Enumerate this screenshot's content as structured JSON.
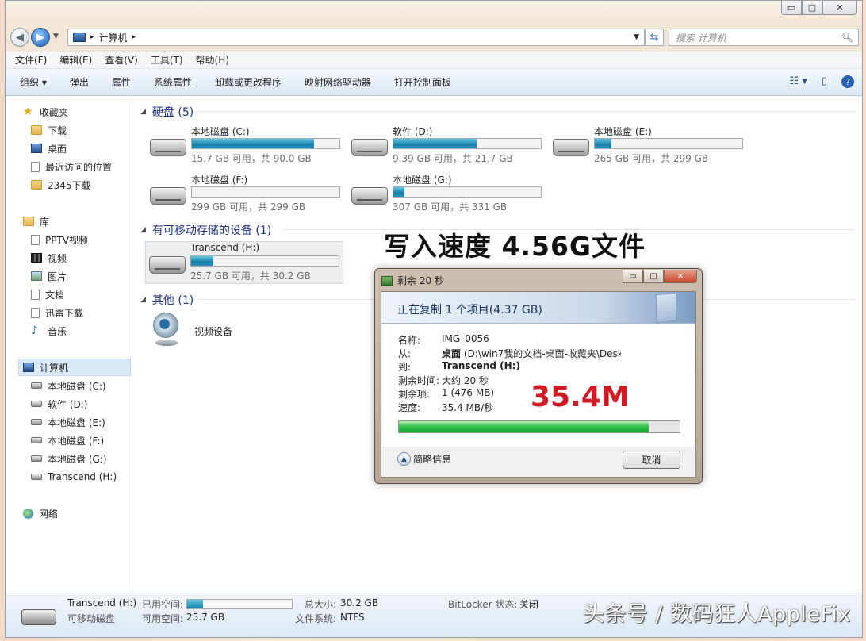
{
  "window": {
    "controls": {
      "minimize": "▭",
      "maximize": "▢",
      "close": "✕"
    }
  },
  "address": {
    "path": "计算机",
    "separator": "▸",
    "search_placeholder": "搜索 计算机"
  },
  "menu": [
    "文件(F)",
    "编辑(E)",
    "查看(V)",
    "工具(T)",
    "帮助(H)"
  ],
  "commands": [
    "组织 ▾",
    "弹出",
    "属性",
    "系统属性",
    "卸载或更改程序",
    "映射网络驱动器",
    "打开控制面板"
  ],
  "nav": {
    "favorites": {
      "label": "收藏夹",
      "items": [
        "下载",
        "桌面",
        "最近访问的位置",
        "2345下载"
      ]
    },
    "libraries": {
      "label": "库",
      "items": [
        "PPTV视频",
        "视频",
        "图片",
        "文档",
        "迅雷下载",
        "音乐"
      ]
    },
    "computer": {
      "label": "计算机",
      "items": [
        "本地磁盘 (C:)",
        "软件 (D:)",
        "本地磁盘 (E:)",
        "本地磁盘 (F:)",
        "本地磁盘 (G:)",
        "Transcend (H:)"
      ]
    },
    "network": {
      "label": "网络"
    }
  },
  "groups": {
    "hdd": "硬盘 (5)",
    "removable": "有可移动存储的设备 (1)",
    "other": "其他 (1)"
  },
  "drives": [
    {
      "name": "本地磁盘 (C:)",
      "info": "15.7 GB 可用，共 90.0 GB",
      "used_fraction": 0.826
    },
    {
      "name": "软件 (D:)",
      "info": "9.39 GB 可用，共 21.7 GB",
      "used_fraction": 0.567
    },
    {
      "name": "本地磁盘 (E:)",
      "info": "265 GB 可用，共 299 GB",
      "used_fraction": 0.114
    },
    {
      "name": "本地磁盘 (F:)",
      "info": "299 GB 可用，共 299 GB",
      "used_fraction": 0.0
    },
    {
      "name": "本地磁盘 (G:)",
      "info": "307 GB 可用，共 331 GB",
      "used_fraction": 0.073
    }
  ],
  "removable": {
    "name": "Transcend (H:)",
    "info": "25.7 GB 可用，共 30.2 GB",
    "used_fraction": 0.149
  },
  "other_device": "视频设备",
  "overlay_title": "写入速度  4.56G文件",
  "dialog": {
    "title": "剩余 20 秒",
    "heading": "正在复制 1 个项目(4.37 GB)",
    "fields": [
      {
        "key": "名称:",
        "value": "IMG_0056"
      },
      {
        "key": "从:",
        "value_bold": "桌面",
        "value": " (D:\\win7我的文档-桌面-收藏夹\\Desk"
      },
      {
        "key": "到:",
        "value_bold": "Transcend (H:)",
        "value": ""
      },
      {
        "key": "剩余时间:",
        "value": "大约 20 秒"
      },
      {
        "key": "剩余项:",
        "value": "1 (476 MB)"
      },
      {
        "key": "速度:",
        "value": "35.4 MB/秒"
      }
    ],
    "speed_big": "35.4M",
    "progress_fraction": 0.89,
    "details_label": "简略信息",
    "cancel_label": "取消"
  },
  "status": {
    "name": "Transcend (H:)",
    "type": "可移动磁盘",
    "used_label": "已用空间:",
    "free_label": "可用空间:",
    "free_value": "25.7 GB",
    "total_label": "总大小:",
    "total_value": "30.2 GB",
    "fs_label": "文件系统:",
    "fs_value": "NTFS",
    "bitlocker_label": "BitLocker 状态:",
    "bitlocker_value": "关闭",
    "used_fraction": 0.149
  },
  "watermark": "头条号 / 数码狂人AppleFix"
}
